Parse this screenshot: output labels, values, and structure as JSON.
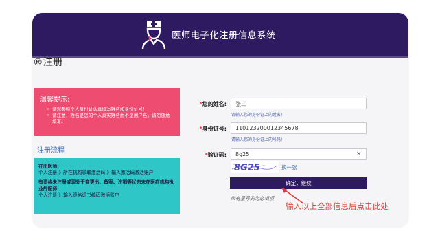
{
  "header": {
    "title": "医师电子化注册信息系统",
    "icon": "doctor-icon"
  },
  "page": {
    "heading": "®注册"
  },
  "notice": {
    "title": "温馨提示:",
    "items": [
      "请您参照个人身份证认真填写姓名和身份证号！",
      "请注意，姓名是您的个人真实姓名而不是用户名，请勿随意填写。"
    ]
  },
  "flow": {
    "title": "注册流程",
    "section1_title": "在册医师:",
    "section1_text": "个人注册 》所在机构领取激活码 》输入激活码激活账户",
    "section2_title": "有资格未注册或现处于变更出、备案、注销等状态未在医疗机构执业的医师:",
    "section2_text": "个人注册 》输入资格证书编码激活账户"
  },
  "form": {
    "name_label": "您的姓名:",
    "name_value": "张三",
    "name_hint": "请输入您的身份证上的姓名!",
    "id_label": "身份证号:",
    "id_value": "110123200012345678",
    "id_hint": "请输入您的身份证上的号码!",
    "captcha_label": "验证码:",
    "captcha_value": "8g25",
    "captcha_image_text": "8G25",
    "clear_symbol": "×",
    "refresh_label": "换一张",
    "submit_label": "确定，继续",
    "required_note": "带有星号的为必填项"
  },
  "annotation": {
    "text": "输入以上全部信息后点击此处",
    "color": "#e53935"
  },
  "colors": {
    "header_bg": "#2e1a60",
    "notice_bg": "#ee4c70",
    "flow_bg": "#2ec6c6",
    "button_bg": "#2e1a60"
  }
}
